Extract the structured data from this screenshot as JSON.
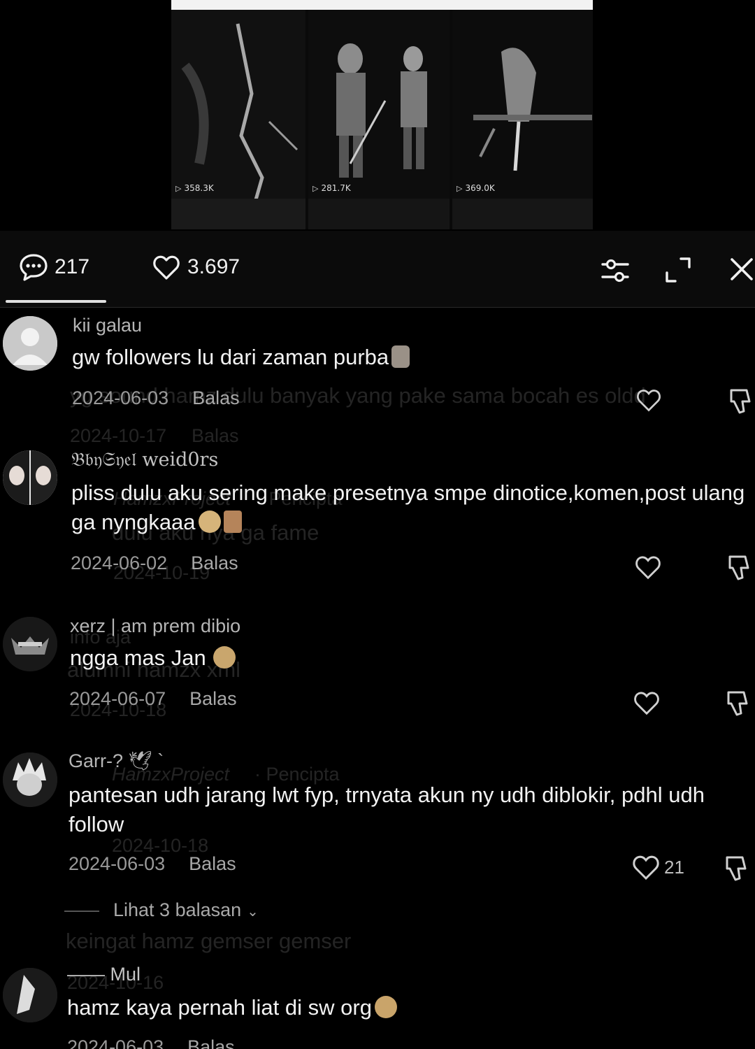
{
  "video": {
    "panels": [
      {
        "plays": "358.3K"
      },
      {
        "plays": "281.7K"
      },
      {
        "plays": "369.0K"
      }
    ]
  },
  "header": {
    "comment_count": "217",
    "like_count": "3.697"
  },
  "comments": [
    {
      "username": "kii galau",
      "text": "gw followers lu dari zaman purba",
      "emoji": "moai",
      "date": "2024-06-03",
      "reply": "Balas",
      "likes": ""
    },
    {
      "username": "𝔅𝔟𝔶𝔖𝔶𝔢𝔩 weid0rs",
      "text": "pliss dulu aku sering make presetnya smpe dinotice,komen,post ulang ga nyngkaaa",
      "emoji": "pleading-face bouquet",
      "date": "2024-06-02",
      "reply": "Balas",
      "likes": ""
    },
    {
      "username": "xerz | am prem dibio",
      "text": "ngga mas Jan",
      "emoji": "pensive-face",
      "date": "2024-06-07",
      "reply": "Balas",
      "likes": ""
    },
    {
      "username": "Garr-? 🕊 `",
      "text": "pantesan udh jarang lwt fyp, trnyata akun ny udh diblokir, pdhl udh follow",
      "emoji": "",
      "date": "2024-06-03",
      "reply": "Balas",
      "likes": "21"
    },
    {
      "username": "—— Mul",
      "text": "hamz kaya pernah liat di sw org",
      "emoji": "thinking-face",
      "date": "2024-06-03",
      "reply": "Balas",
      "likes": ""
    }
  ],
  "view_replies": "Lihat 3 balasan",
  "ghost_layer": {
    "line1": "yg sound hamz dulu banyak yang pake sama bocah es oldd",
    "line2": "2024-10-17",
    "line3": "Balas",
    "line4": "HamzxProject",
    "line5": "· Pencipta",
    "line6": "dulu aku nya ga fame",
    "line7": "2024-10-19",
    "line8": "info aja",
    "line9": "alumni hamzx xml",
    "line10": "2024-10-18",
    "line11": "keingat hamz gemser gemser",
    "line12": "2024-10-16"
  },
  "colors": {
    "background": "#000000",
    "header_bg": "#0b0b0b",
    "text_primary": "#f2f2f2",
    "text_secondary": "#9a9a9a",
    "underline": "#e0e0e0"
  }
}
